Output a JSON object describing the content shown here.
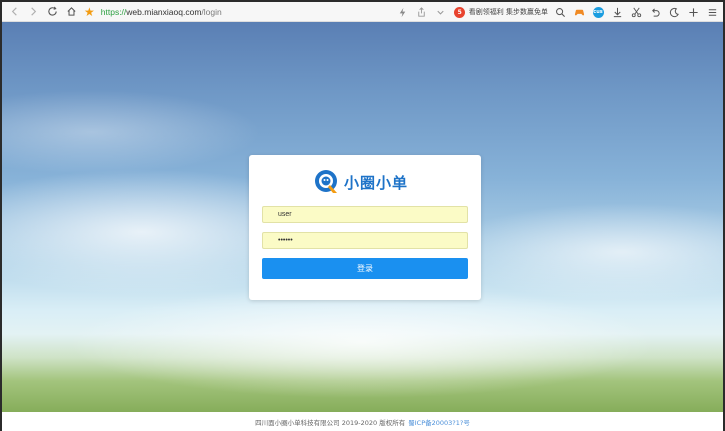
{
  "browser": {
    "url_scheme": "https://",
    "url_host": "web.mianxiaoq.com",
    "url_path": "/login",
    "news_text": "看剧领福利 集步数赢免单",
    "badge_red_text": "5",
    "badge_blue_text": "cus"
  },
  "login": {
    "logo_text": "小圈小单",
    "username_value": "user",
    "password_value": "••••••",
    "submit_label": "登录"
  },
  "footer": {
    "copyright": "四川面小圈小单科技有限公司 2019-2020 版权所有",
    "icp": "蜀ICP备20003?1?号"
  },
  "colors": {
    "primary": "#1a90f0",
    "input_fill": "#fbfbc6",
    "url_scheme": "#2ea043"
  }
}
